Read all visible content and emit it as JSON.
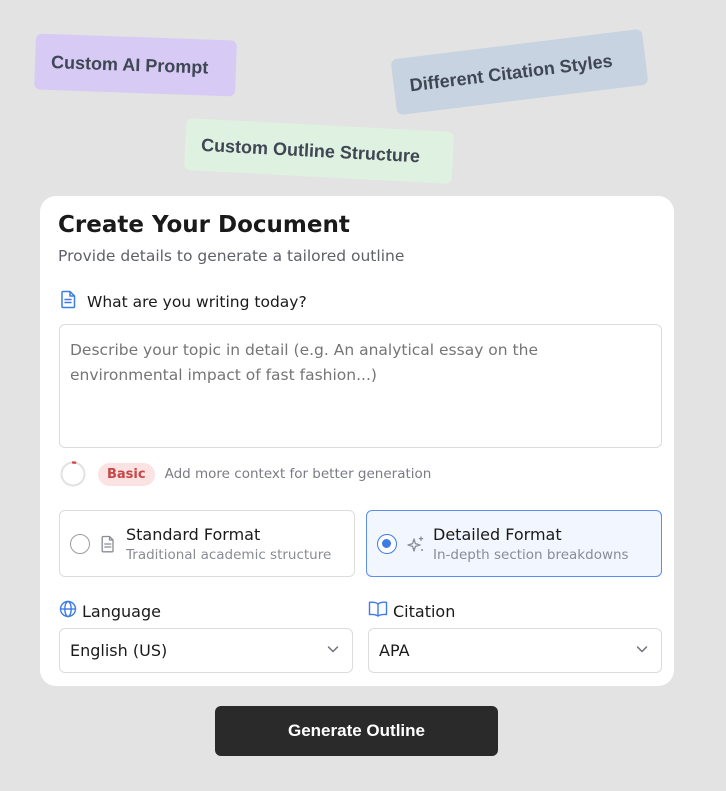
{
  "tags": {
    "custom_prompt": "Custom AI Prompt",
    "citation_styles": "Different Citation Styles",
    "outline_structure": "Custom Outline Structure"
  },
  "card": {
    "title": "Create Your Document",
    "subtitle": "Provide details to generate a tailored outline",
    "question_label": "What are you writing today?",
    "topic_placeholder": "Describe your topic in detail (e.g. An analytical essay on the environmental impact of fast fashion...)",
    "topic_value": "",
    "quality": {
      "badge": "Basic",
      "hint": "Add more context for better generation",
      "progress": 0.03
    },
    "formats": [
      {
        "title": "Standard Format",
        "description": "Traditional academic structure",
        "selected": false,
        "icon": "document-icon"
      },
      {
        "title": "Detailed Format",
        "description": "In-depth section breakdowns",
        "selected": true,
        "icon": "sparkles-icon"
      }
    ],
    "language": {
      "label": "Language",
      "value": "English (US)",
      "icon": "globe-icon"
    },
    "citation": {
      "label": "Citation",
      "value": "APA",
      "icon": "book-icon"
    }
  },
  "generate_button": "Generate Outline",
  "colors": {
    "background": "#e3e3e3",
    "accent_blue": "#3d7be6",
    "badge_red": "#c74646",
    "tag_purple": "#d7cbf5",
    "tag_blue": "#c8d3e1",
    "tag_green": "#dff1e0",
    "button_dark": "#2a2a2a"
  }
}
